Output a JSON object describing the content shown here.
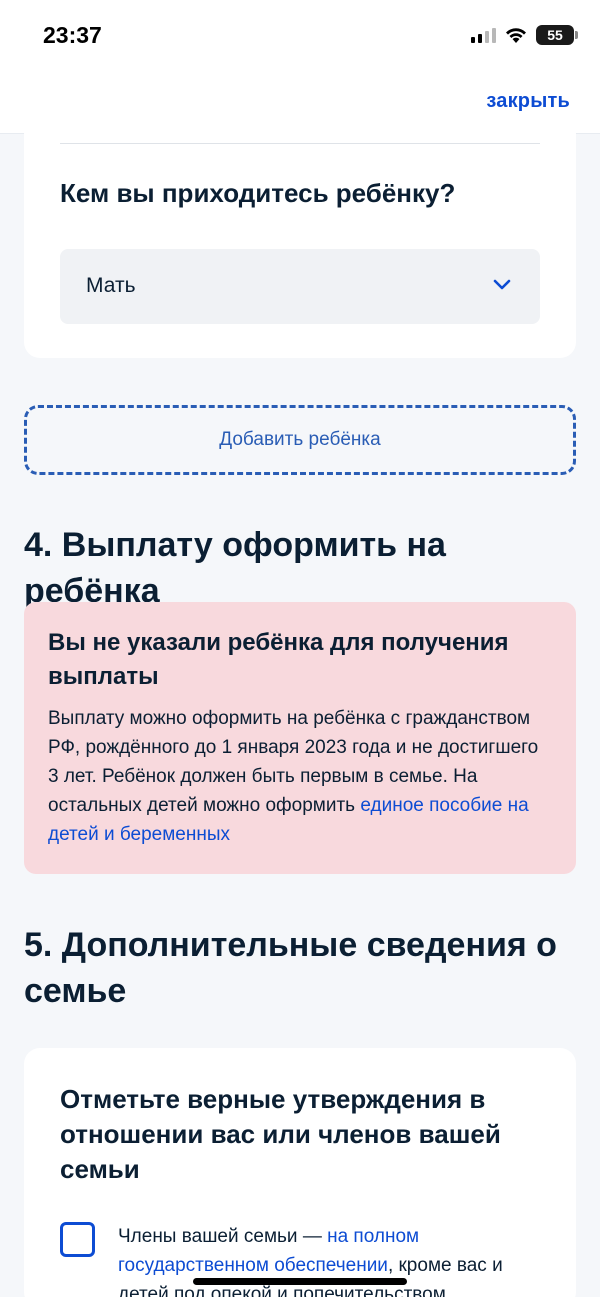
{
  "status_bar": {
    "time": "23:37",
    "battery": "55"
  },
  "nav": {
    "close_label": "закрыть"
  },
  "relation": {
    "question": "Кем вы приходитесь ребёнку?",
    "selected_value": "Мать"
  },
  "add_child_label": "Добавить ребёнка",
  "section4": {
    "title": "4. Выплату оформить на ребёнка",
    "alert_title": "Вы не указали ребёнка для получения выплаты",
    "alert_text": "Выплату можно оформить на ребёнка с гражданством РФ, рождённого до 1 января 2023 года и не достигшего 3 лет. Ребёнок должен быть первым в семье. На остальных детей можно оформить ",
    "alert_link": "единое пособие на детей и беременных"
  },
  "section5": {
    "title": "5. Дополнительные сведения о семье",
    "card_title": "Отметьте верные утверждения в отношении вас или членов вашей семьи",
    "checkbox_text_before": "Члены вашей семьи — ",
    "checkbox_link": "на полном государственном обеспечении",
    "checkbox_text_after": ", кроме вас и детей под опекой и попечительством"
  },
  "colors": {
    "accent": "#0d4cd3",
    "alert_bg": "#f8d9dd",
    "page_bg": "#f5f7fa"
  }
}
